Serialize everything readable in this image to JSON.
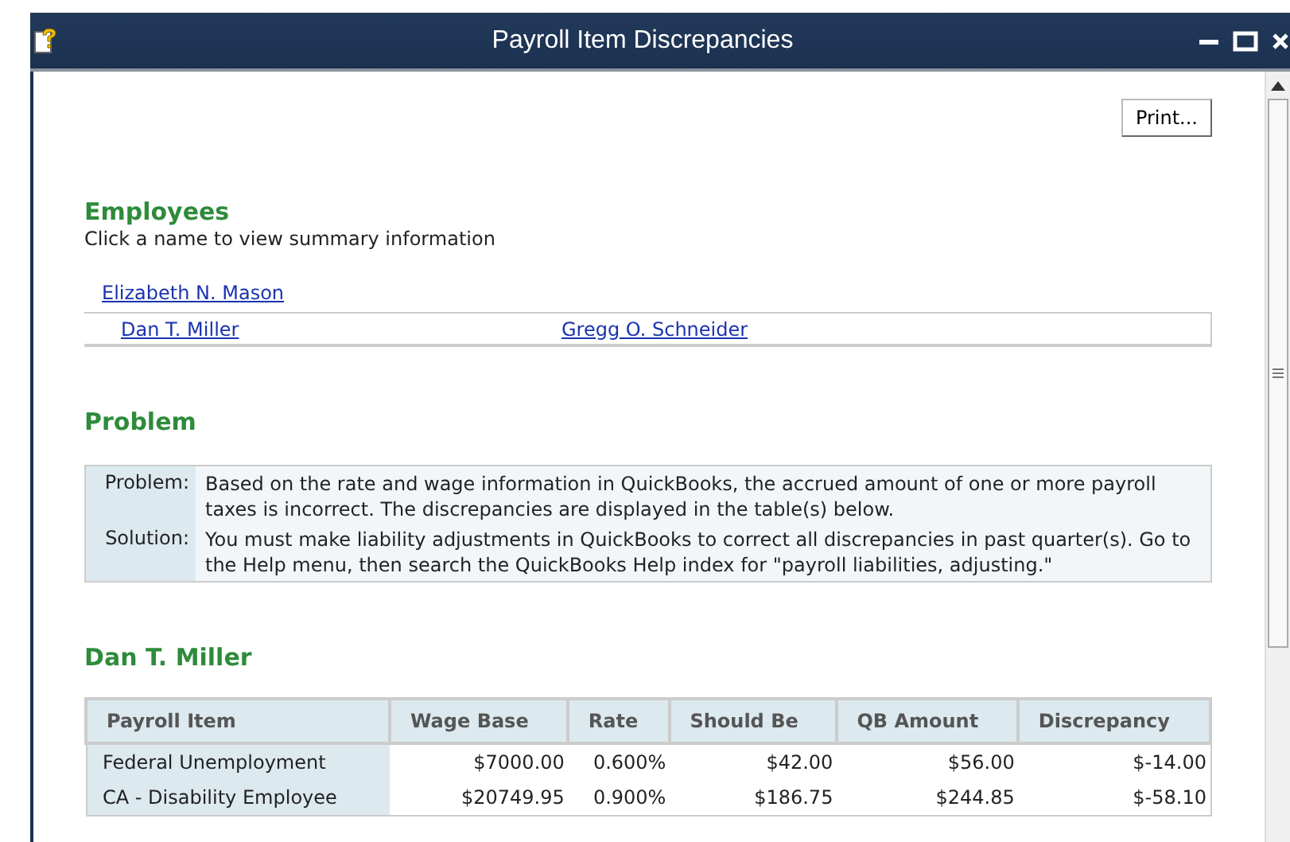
{
  "window": {
    "title": "Payroll Item Discrepancies"
  },
  "print_button": "Print...",
  "employees": {
    "heading": "Employees",
    "hint": "Click a name to view summary information",
    "links": [
      {
        "label": "Elizabeth N. Mason"
      },
      {
        "label": "Dan T. Miller"
      },
      {
        "label": "Gregg O. Schneider"
      }
    ]
  },
  "problem": {
    "heading": "Problem",
    "rows": [
      {
        "label": "Problem:",
        "text": "Based on the rate and wage information in QuickBooks, the accrued amount of one or more payroll taxes is incorrect. The discrepancies are displayed in the table(s) below."
      },
      {
        "label": "Solution:",
        "text": "You must make liability adjustments in QuickBooks to correct all discrepancies in past quarter(s). Go to the Help menu, then search the QuickBooks Help index for \"payroll liabilities, adjusting.\""
      }
    ]
  },
  "employee_section": {
    "heading": "Dan T. Miller",
    "table": {
      "columns": [
        "Payroll Item",
        "Wage Base",
        "Rate",
        "Should Be",
        "QB Amount",
        "Discrepancy"
      ],
      "rows": [
        [
          "Federal Unemployment",
          "$7000.00",
          "0.600%",
          "$42.00",
          "$56.00",
          "$-14.00"
        ],
        [
          "CA - Disability Employee",
          "$20749.95",
          "0.900%",
          "$186.75",
          "$244.85",
          "$-58.10"
        ]
      ]
    }
  }
}
